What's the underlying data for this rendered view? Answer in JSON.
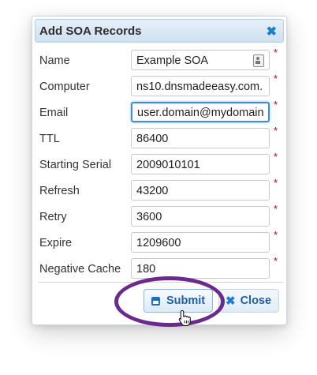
{
  "dialog": {
    "title": "Add SOA Records",
    "close_glyph": "✖",
    "required_mark": "*"
  },
  "fields": [
    {
      "label": "Name",
      "value": "Example SOA",
      "icon": "contact-card-icon"
    },
    {
      "label": "Computer",
      "value": "ns10.dnsmadeeasy.com."
    },
    {
      "label": "Email",
      "value": "user.domain@mydomain",
      "focused": true
    },
    {
      "label": "TTL",
      "value": "86400"
    },
    {
      "label": "Starting Serial",
      "value": "2009010101"
    },
    {
      "label": "Refresh",
      "value": "43200"
    },
    {
      "label": "Retry",
      "value": "3600"
    },
    {
      "label": "Expire",
      "value": "1209600"
    },
    {
      "label": "Negative Cache",
      "value": "180"
    }
  ],
  "buttons": {
    "submit_label": "Submit",
    "close_label": "Close",
    "close_glyph": "✖"
  },
  "colors": {
    "accent": "#1f7ecb",
    "required": "#d40000",
    "highlight_ring": "#6a2a8e"
  }
}
